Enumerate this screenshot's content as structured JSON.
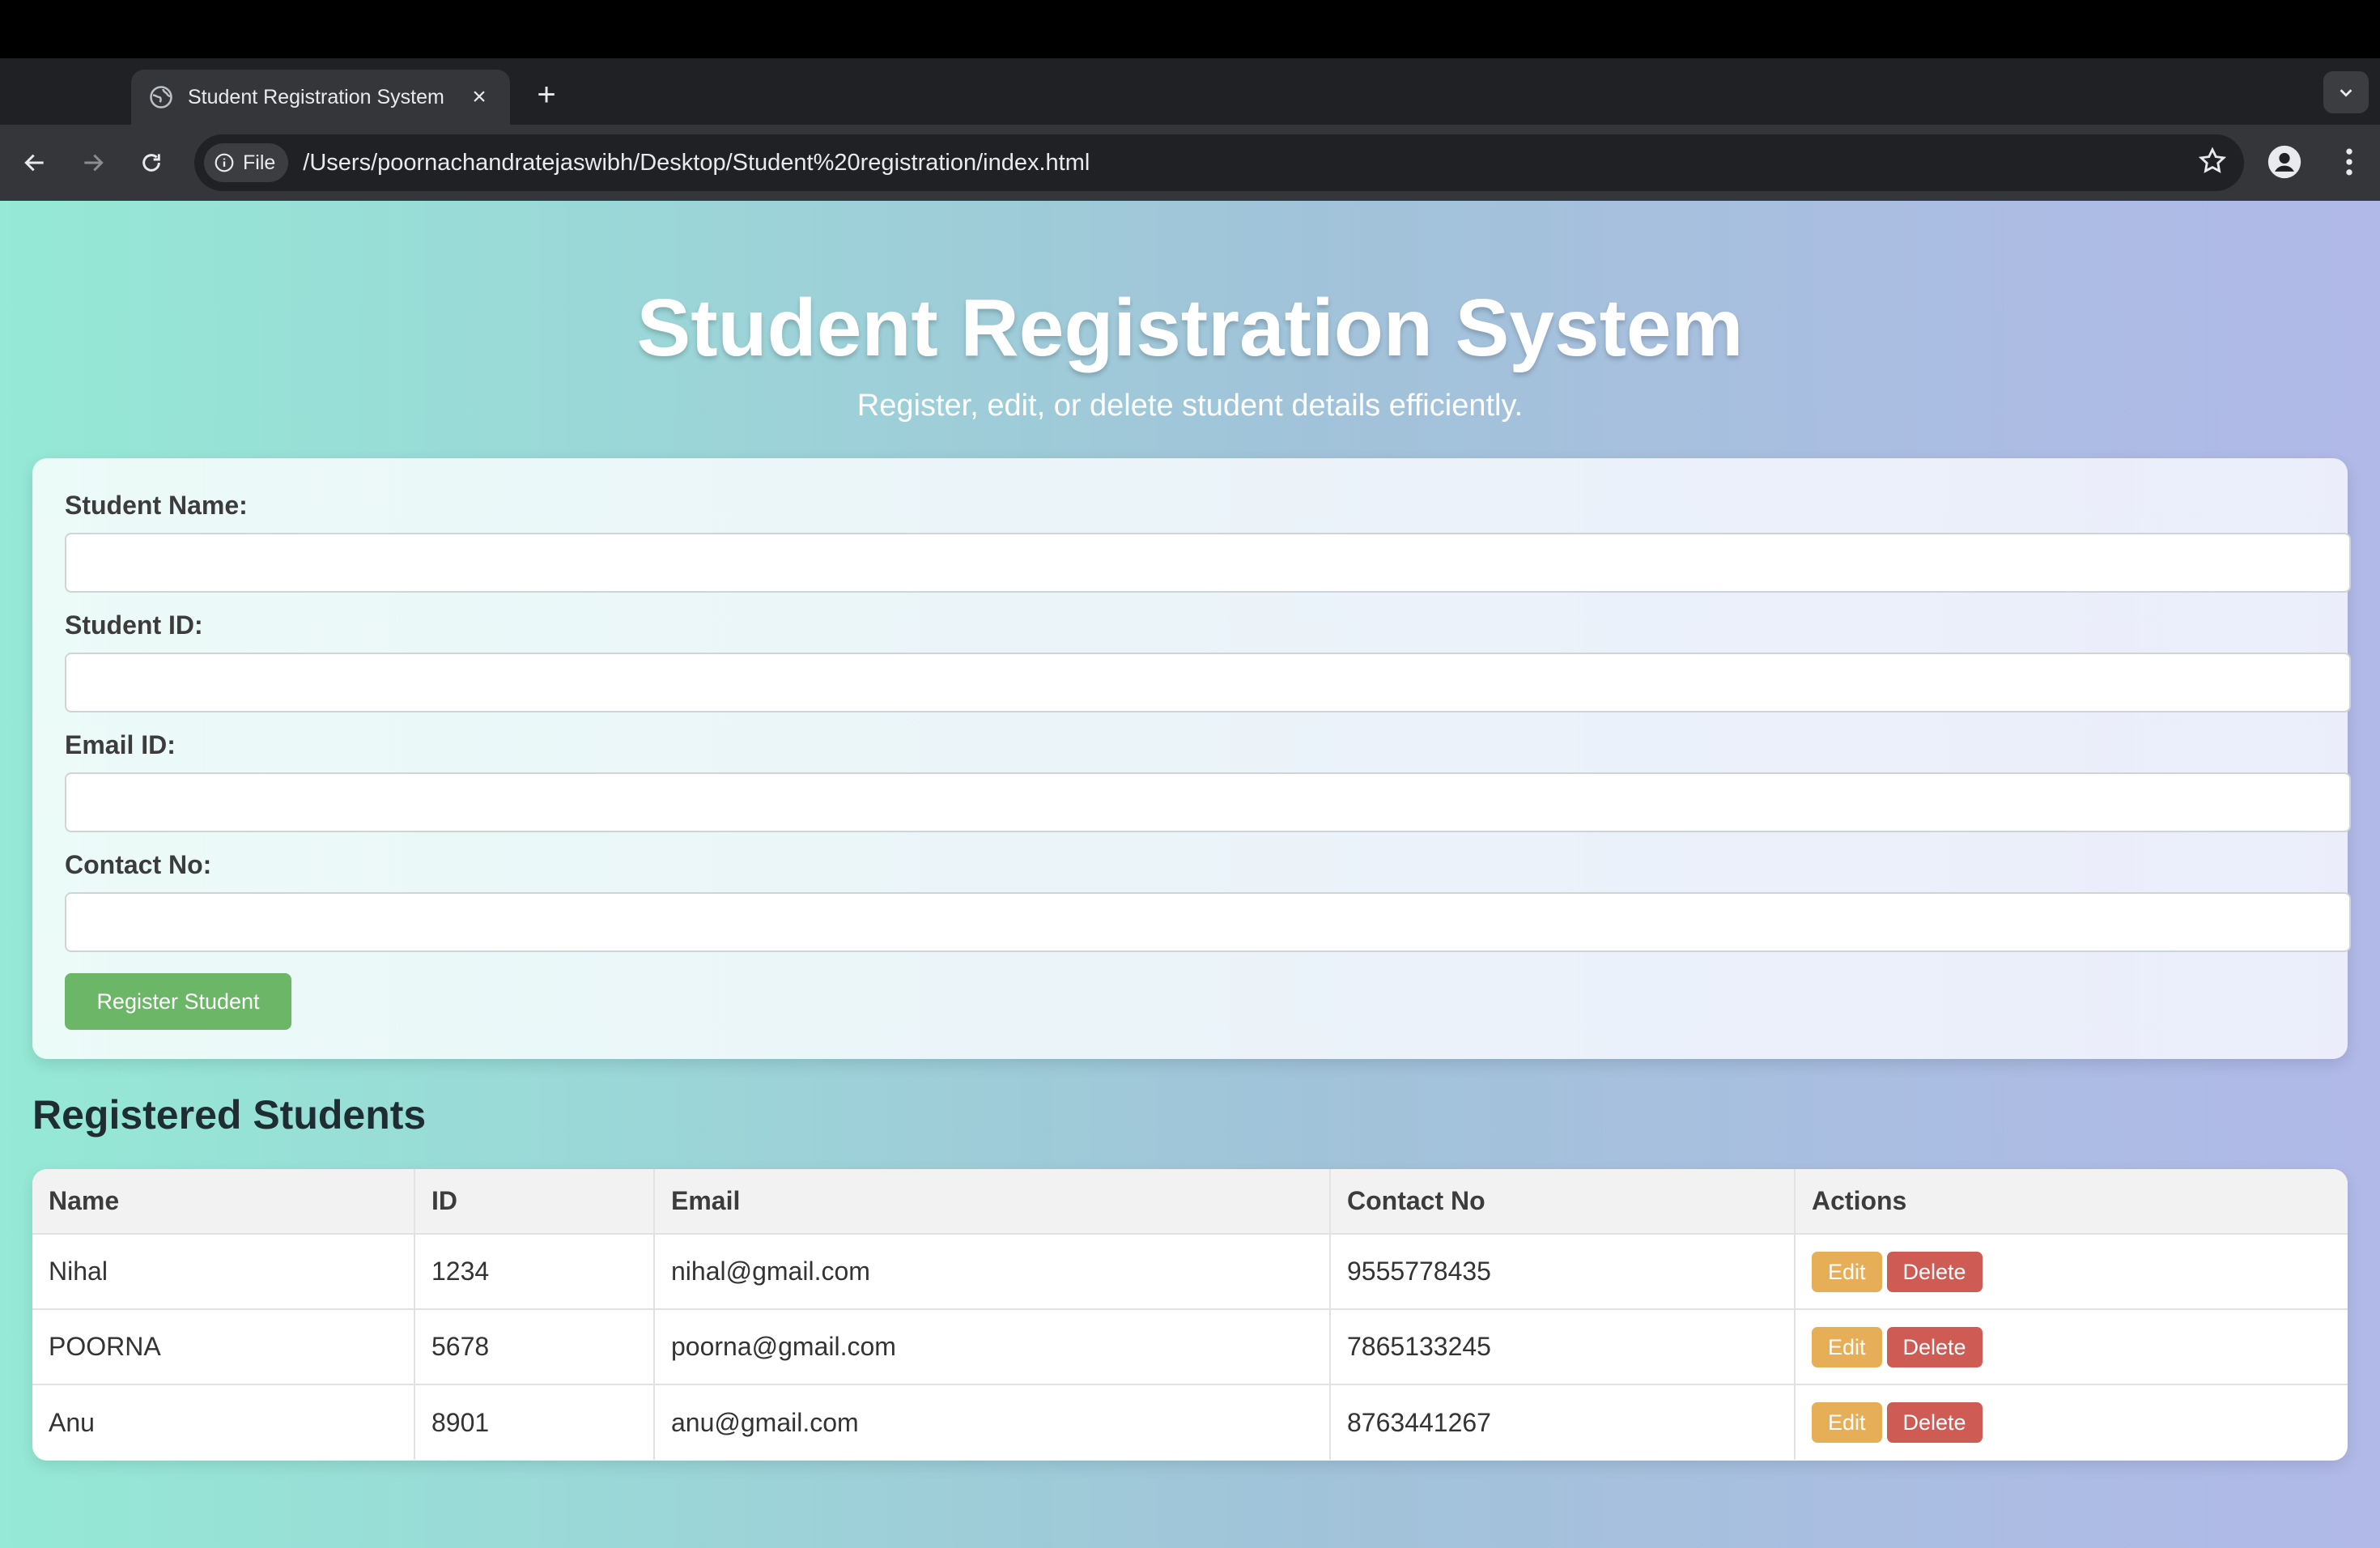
{
  "browser": {
    "tab_title": "Student Registration System",
    "new_tab_symbol": "+",
    "close_symbol": "×",
    "url_chip": "File",
    "url": "/Users/poornachandratejaswibh/Desktop/Student%20registration/index.html",
    "icons": [
      "globe-icon",
      "back-icon",
      "forward-icon",
      "reload-icon",
      "info-icon",
      "star-icon",
      "profile-icon",
      "kebab-menu-icon",
      "tab-list-icon"
    ]
  },
  "page": {
    "title": "Student Registration System",
    "subtitle": "Register, edit, or delete student details efficiently.",
    "form": {
      "name_label": "Student Name:",
      "id_label": "Student ID:",
      "email_label": "Email ID:",
      "contact_label": "Contact No:",
      "name_value": "",
      "id_value": "",
      "email_value": "",
      "contact_value": "",
      "register_label": "Register Student"
    },
    "list_title": "Registered Students",
    "table": {
      "headers": [
        "Name",
        "ID",
        "Email",
        "Contact No",
        "Actions"
      ],
      "rows": [
        {
          "name": "Nihal",
          "id": "1234",
          "email": "nihal@gmail.com",
          "contact": "9555778435"
        },
        {
          "name": "POORNA",
          "id": "5678",
          "email": "poorna@gmail.com",
          "contact": "7865133245"
        },
        {
          "name": "Anu",
          "id": "8901",
          "email": "anu@gmail.com",
          "contact": "8763441267"
        }
      ],
      "edit_label": "Edit",
      "delete_label": "Delete"
    }
  },
  "colors": {
    "gradient_start": "#95e9d6",
    "gradient_end": "#b1b9e8",
    "register_button": "#6cb668",
    "edit_button": "#e7ae58",
    "delete_button": "#cf5c54"
  }
}
